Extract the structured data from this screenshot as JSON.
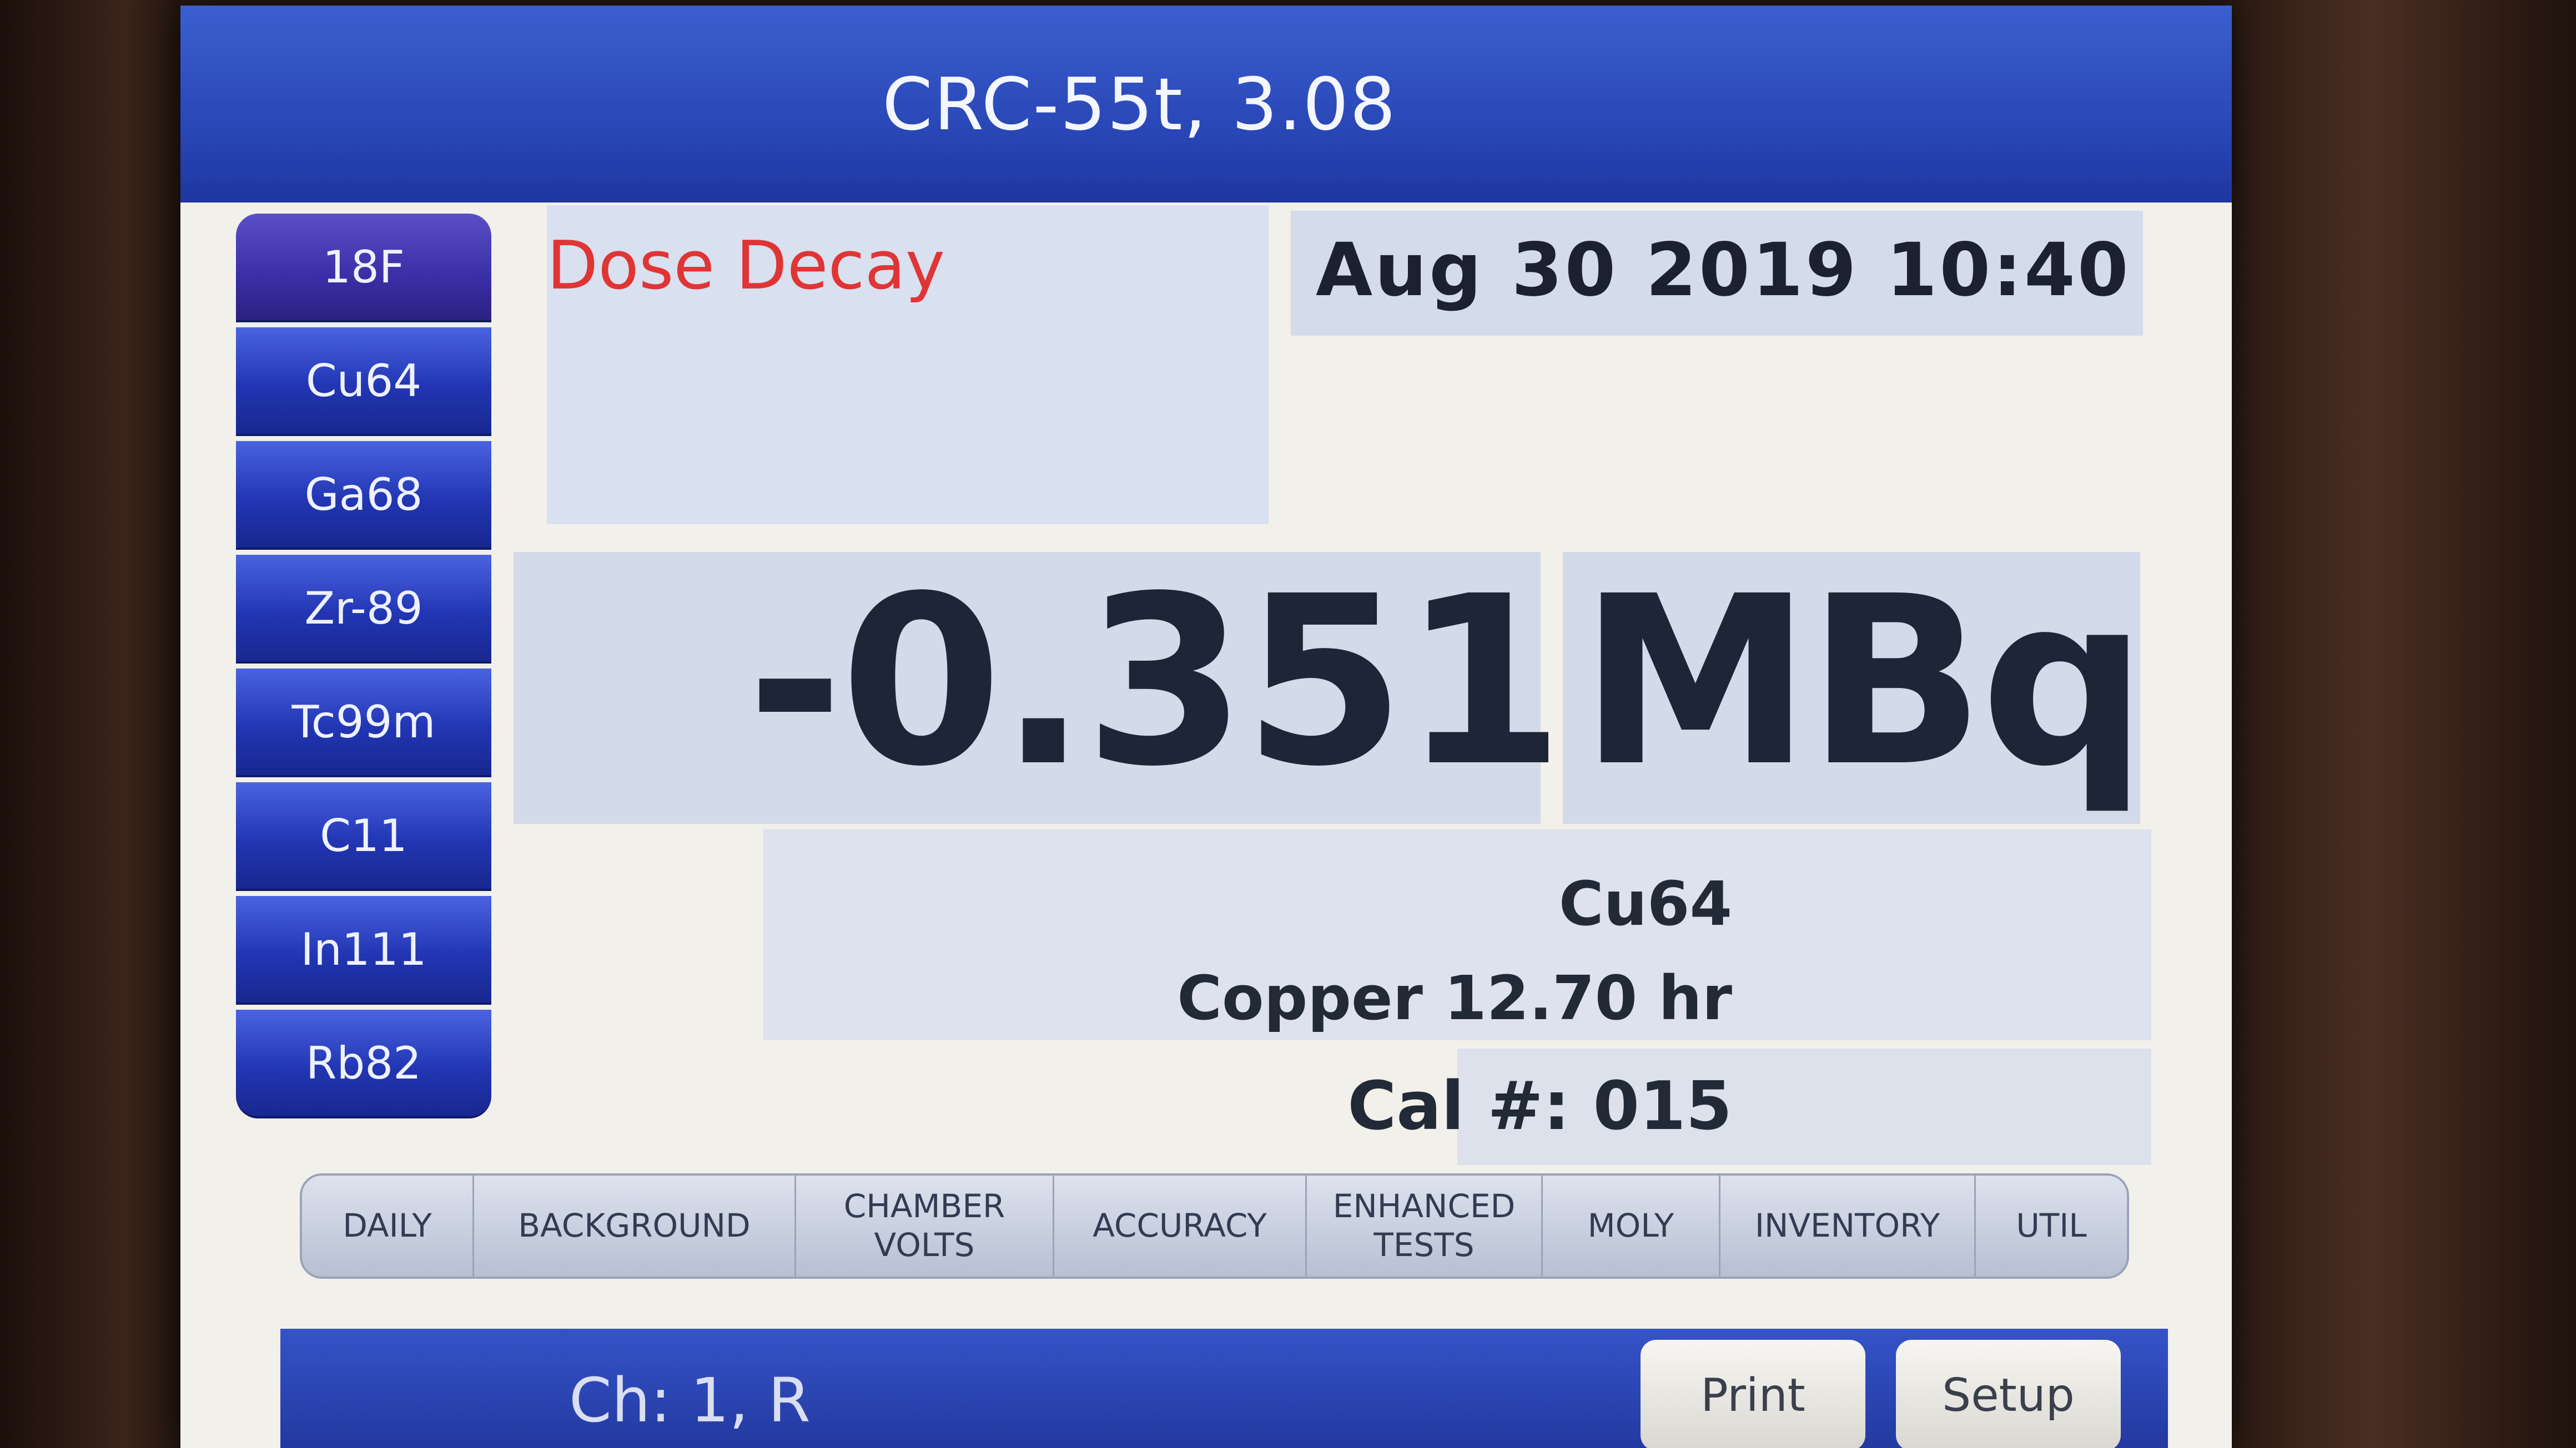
{
  "window": {
    "title": "CRC-55t, 3.08"
  },
  "isotope_keys": [
    "18F",
    "Cu64",
    "Ga68",
    "Zr-89",
    "Tc99m",
    "C11",
    "In111",
    "Rb82"
  ],
  "mode": {
    "label": "Dose Decay"
  },
  "datetime": "Aug 30 2019 10:40",
  "measurement": {
    "value": "-0.351",
    "unit": "MBq",
    "isotope": "Cu64",
    "half_life": "Copper 12.70 hr",
    "calibration": "Cal #: 015"
  },
  "tabs": [
    "DAILY",
    "BACKGROUND",
    "CHAMBER\nVOLTS",
    "ACCURACY",
    "ENHANCED\nTESTS",
    "MOLY",
    "INVENTORY",
    "UTIL"
  ],
  "status": {
    "channel": "Ch: 1, R",
    "print_label": "Print",
    "setup_label": "Setup"
  },
  "colors": {
    "title_bar": "#2a48b8",
    "isotope_button": "#2236b4",
    "mode_label": "#e03535",
    "reading_text": "#1d2536"
  }
}
